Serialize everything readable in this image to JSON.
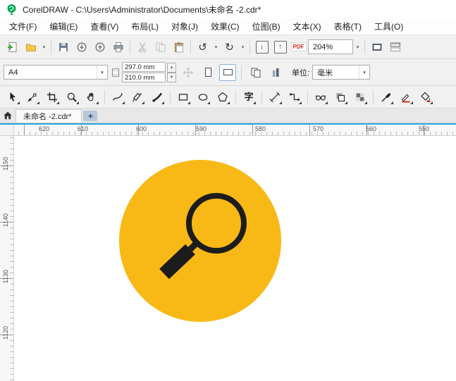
{
  "window": {
    "title": "CorelDRAW - C:\\Users\\Administrator\\Documents\\未命名 -2.cdr*"
  },
  "menu": {
    "items": [
      "文件(F)",
      "编辑(E)",
      "查看(V)",
      "布局(L)",
      "对象(J)",
      "效果(C)",
      "位图(B)",
      "文本(X)",
      "表格(T)",
      "工具(O)"
    ]
  },
  "standard_toolbar": {
    "zoom_value": "204%",
    "pdf_label": "PDF",
    "undo_glyph": "↺",
    "redo_glyph": "↻",
    "import_glyph": "↓",
    "export_glyph": "↑",
    "dropdown_glyph": "▾"
  },
  "property_bar": {
    "page_size_value": "A4",
    "page_width_value": "297.0 mm",
    "page_height_value": "210.0 mm",
    "spinner_up": "▴",
    "spinner_down": "▾",
    "units_label": "单位:",
    "units_value": "毫米",
    "dropdown_glyph": "▾"
  },
  "toolbox": {
    "text_tool_glyph": "字"
  },
  "tab_bar": {
    "active_tab": "未命名 -2.cdr*",
    "new_tab_glyph": "+"
  },
  "rulers": {
    "horizontal_labels": [
      "620",
      "610",
      "600",
      "590",
      "580",
      "570",
      "560",
      "550"
    ],
    "vertical_labels": [
      "1150",
      "1140",
      "1130",
      "1120"
    ]
  },
  "canvas": {
    "object_name": "magnifier-search-graphic",
    "circle_color": "#F8B815",
    "glyph_color": "#1C1C1C"
  }
}
